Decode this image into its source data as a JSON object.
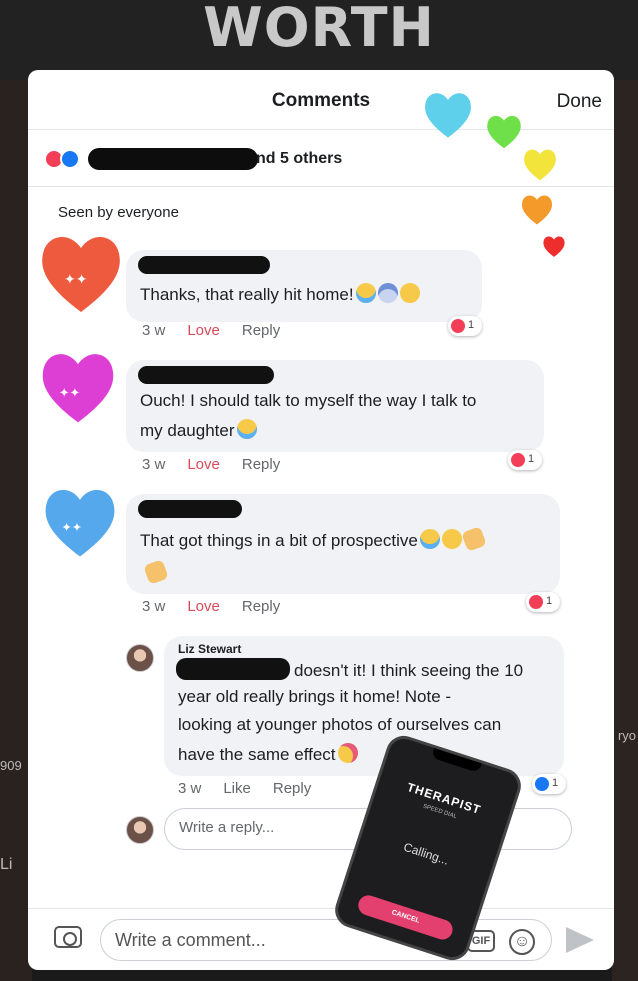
{
  "background": {
    "title": "WORTH",
    "left_number": "909",
    "left_text": "Li",
    "right_text": "ryo"
  },
  "header": {
    "title": "Comments",
    "done_label": "Done"
  },
  "reactions": {
    "summary": "nd 5 others",
    "seen_by": "Seen by everyone"
  },
  "comments": [
    {
      "text": "Thanks, that really hit home!",
      "time": "3 w",
      "action": "Love",
      "reply": "Reply",
      "reaction_count": "1",
      "reaction_type": "love"
    },
    {
      "text_line1": "Ouch! I should talk to myself the way I talk to",
      "text_line2": "my daughter",
      "time": "3 w",
      "action": "Love",
      "reply": "Reply",
      "reaction_count": "1",
      "reaction_type": "love"
    },
    {
      "text": "That got things in a bit of prospective",
      "time": "3 w",
      "action": "Love",
      "reply": "Reply",
      "reaction_count": "1",
      "reaction_type": "love"
    }
  ],
  "reply": {
    "author": "Liz Stewart",
    "line1": "doesn't it! I think seeing the 10",
    "line2": "year old really brings it home! Note -",
    "line3": "looking at younger photos of ourselves can",
    "line4": "have the same effect",
    "time": "3 w",
    "action": "Like",
    "reply": "Reply",
    "reaction_count": "1",
    "reaction_type": "like"
  },
  "reply_input": {
    "placeholder": "Write a reply..."
  },
  "comment_input": {
    "placeholder": "Write a comment...",
    "gif_label": "GIF"
  },
  "phone_sticker": {
    "title": "THERAPIST",
    "subtitle": "SPEED DIAL",
    "status": "Calling...",
    "button": "CANCEL"
  },
  "colors": {
    "love": "#f33e58",
    "like": "#1877f2",
    "bubble": "#f0f2f5"
  }
}
